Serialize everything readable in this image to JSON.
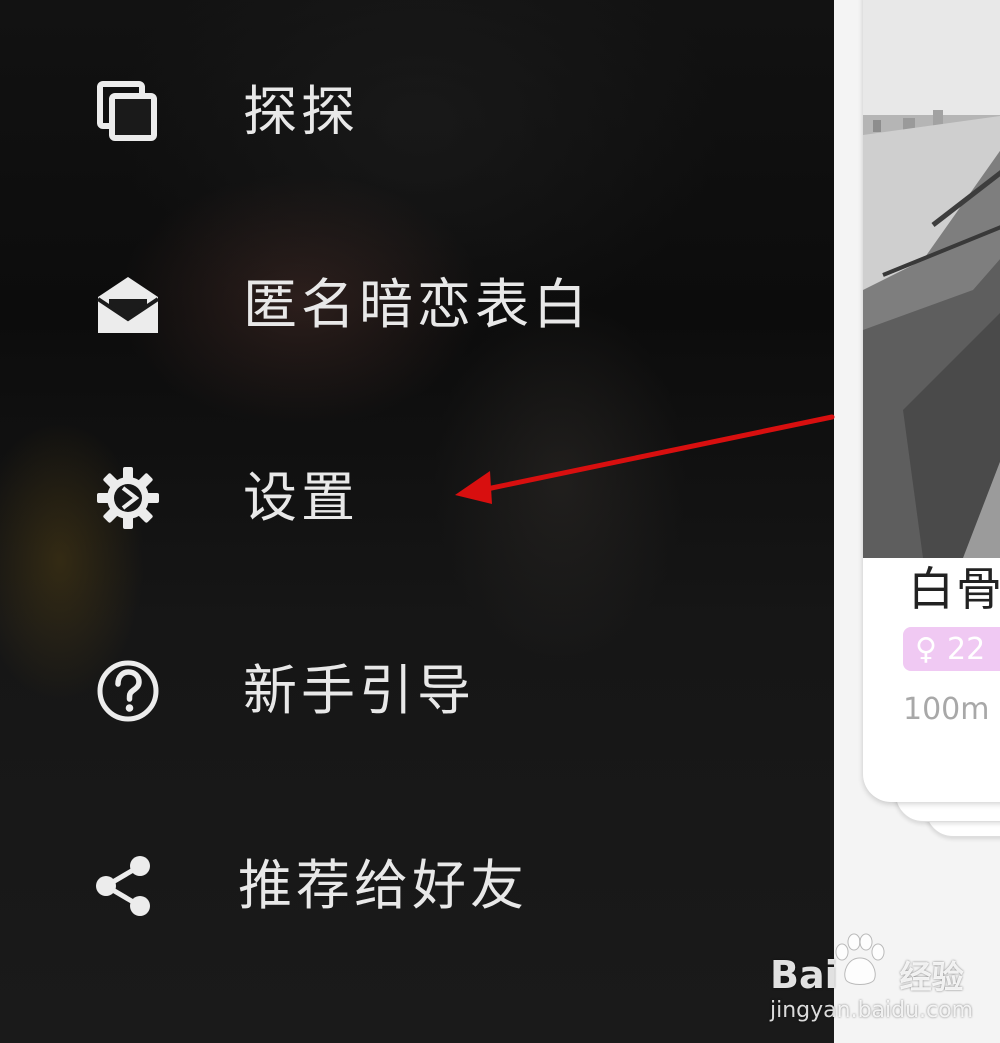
{
  "menu": {
    "items": [
      {
        "label": "探探",
        "icon": "photo-stack-icon"
      },
      {
        "label": "匿名暗恋表白",
        "icon": "open-envelope-icon"
      },
      {
        "label": "设置",
        "icon": "gear-icon"
      },
      {
        "label": "新手引导",
        "icon": "help-circle-icon"
      },
      {
        "label": "推荐给好友",
        "icon": "share-icon"
      }
    ]
  },
  "card": {
    "name": "白骨",
    "gender_symbol": "♀",
    "age": "22",
    "distance": "100m"
  },
  "annotation": {
    "arrow_color": "#d80f0f",
    "points_to": "设置"
  },
  "watermark": {
    "brand": "Bai",
    "brand_suffix": "经验",
    "url": "jingyan.baidu.com"
  },
  "colors": {
    "drawer_text": "#e8e8e8",
    "badge_bg": "#f0c9f3",
    "distance_text": "#a8a8a8"
  }
}
